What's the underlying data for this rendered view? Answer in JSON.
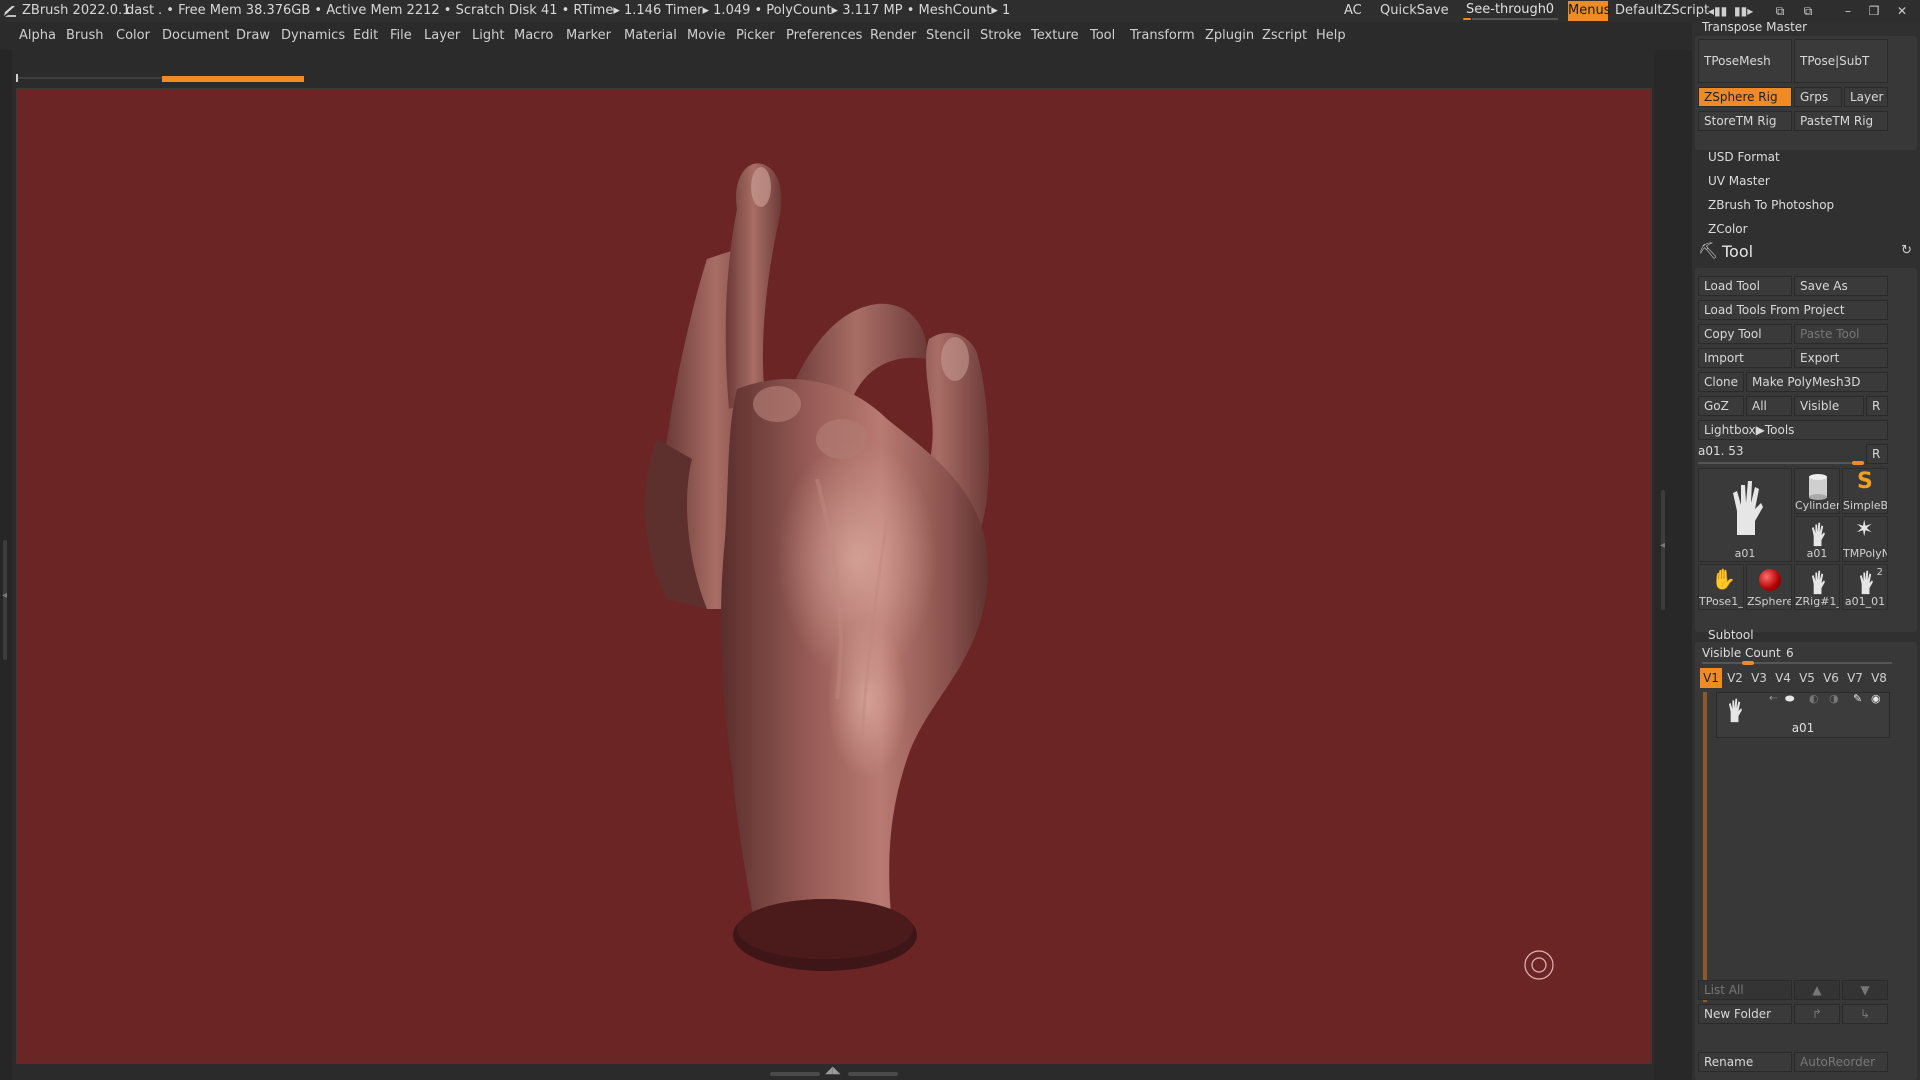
{
  "titlebar": {
    "app": "ZBrush 2022.0.1",
    "doc": "dast",
    "stats": ". • Free Mem 38.376GB • Active Mem 2212 • Scratch Disk 41 •  RTime▸ 1.146 Timer▸ 1.049 • PolyCount▸ 3.117 MP  • MeshCount▸ 1",
    "ac": "AC",
    "quicksave": "QuickSave",
    "see_through_label": "See-through",
    "see_through_value": "0",
    "see_through_level": 0,
    "menus": "Menus",
    "script": "DefaultZScript",
    "accent": "#f08a24"
  },
  "menubar": [
    "Alpha",
    "Brush",
    "Color",
    "Document",
    "Draw",
    "Dynamics",
    "Edit",
    "File",
    "Layer",
    "Light",
    "Macro",
    "Marker",
    "Material",
    "Movie",
    "Picker",
    "Preferences",
    "Render",
    "Stencil",
    "Stroke",
    "Texture",
    "Tool",
    "Transform",
    "Zplugin",
    "Zscript",
    "Help"
  ],
  "canvas": {
    "background": "#6b2525",
    "model": "hand"
  },
  "panel": {
    "transpose_master": "Transpose Master",
    "tposemesh": "TPoseMesh",
    "tpose_subt": "TPose|SubT",
    "zsphere_rig": "ZSphere Rig",
    "grps": "Grps",
    "layer": "Layer",
    "storetm_rig": "StoreTM Rig",
    "pastetm_rig": "PasteTM Rig",
    "usd_format": "USD Format",
    "uv_master": "UV Master",
    "zbrush_to_photoshop": "ZBrush To Photoshop",
    "zcolor": "ZColor",
    "tool": "Tool",
    "load_tool": "Load Tool",
    "save_as": "Save As",
    "load_tools_from_project": "Load Tools From Project",
    "copy_tool": "Copy Tool",
    "paste_tool": "Paste Tool",
    "import": "Import",
    "export": "Export",
    "clone": "Clone",
    "make_polymesh3d": "Make PolyMesh3D",
    "goz": "GoZ",
    "all": "All",
    "visible": "Visible",
    "r": "R",
    "lightbox_tools": "Lightbox▶Tools",
    "current_tool": "a01. 53",
    "tool_slider_r": "R",
    "thumbs": {
      "main": "a01",
      "cylinder": "Cylinder",
      "simpleb": "SimpleB",
      "a01_small": "a01",
      "tmpoly": "TMPolyN",
      "tpose1": "TPose1_",
      "zsphere": "ZSphere",
      "zrig": "ZRig#1_",
      "a01_01": "a01_01",
      "a01_01_count": "2"
    },
    "subtool": "Subtool",
    "visible_count_label": "Visible Count",
    "visible_count_value": "6",
    "v_buttons": [
      "V1",
      "V2",
      "V3",
      "V4",
      "V5",
      "V6",
      "V7",
      "V8"
    ],
    "subtool_item": "a01",
    "list_all": "List All",
    "new_folder": "New Folder",
    "rename": "Rename",
    "autoreorder": "AutoReorder"
  }
}
